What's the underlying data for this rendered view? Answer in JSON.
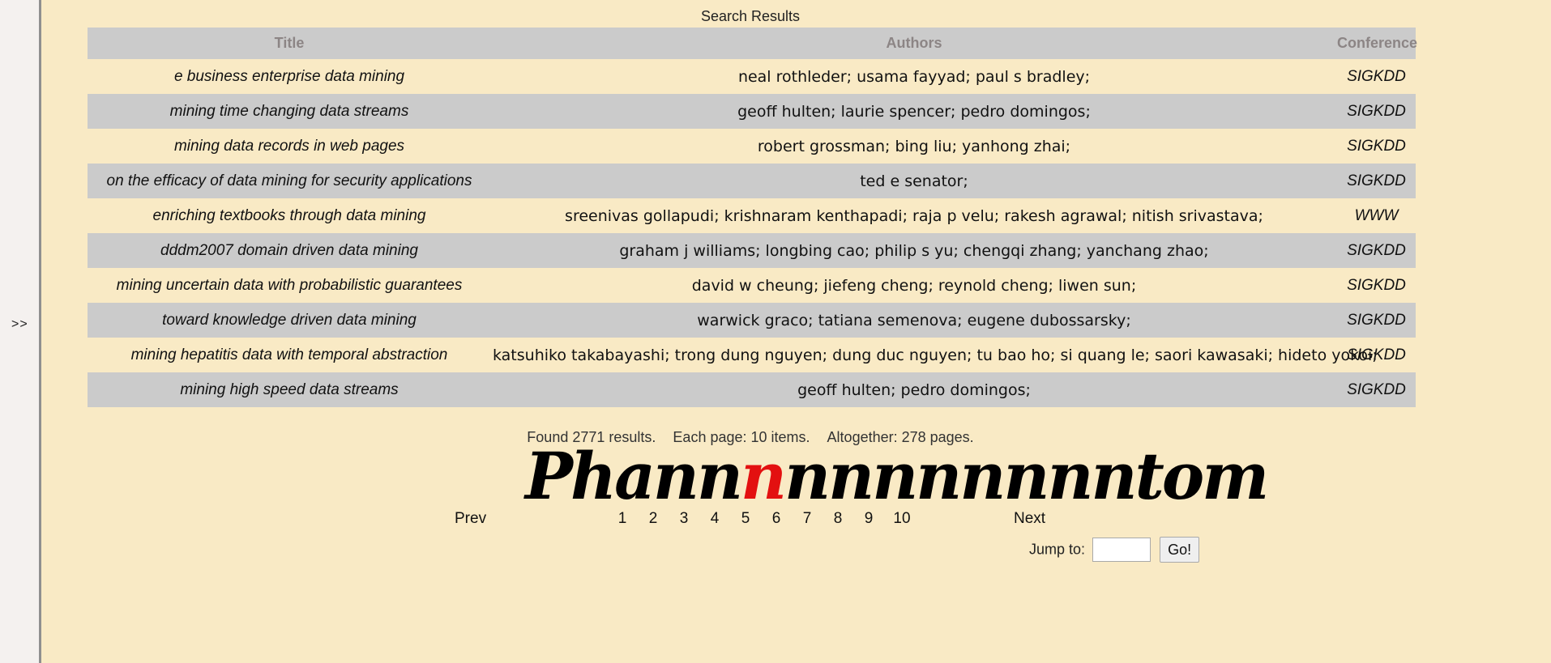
{
  "sidebar": {
    "toggle_label": ">>"
  },
  "heading": "Search Results",
  "table": {
    "headers": [
      "Title",
      "Authors",
      "Conference"
    ],
    "rows": [
      {
        "title": "e business enterprise data mining",
        "authors": "neal rothleder; usama fayyad; paul s bradley;",
        "conference": "SIGKDD"
      },
      {
        "title": "mining time changing data streams",
        "authors": "geoff hulten; laurie spencer; pedro domingos;",
        "conference": "SIGKDD"
      },
      {
        "title": "mining data records in web pages",
        "authors": "robert grossman; bing liu; yanhong zhai;",
        "conference": "SIGKDD"
      },
      {
        "title": "on the efficacy of data mining for security applications",
        "authors": "ted e senator;",
        "conference": "SIGKDD"
      },
      {
        "title": "enriching textbooks through data mining",
        "authors": "sreenivas gollapudi; krishnaram kenthapadi; raja p velu; rakesh agrawal; nitish srivastava;",
        "conference": "WWW"
      },
      {
        "title": "dddm2007 domain driven data mining",
        "authors": "graham j williams; longbing cao; philip s yu; chengqi zhang; yanchang zhao;",
        "conference": "SIGKDD"
      },
      {
        "title": "mining uncertain data with probabilistic guarantees",
        "authors": "david w cheung; jiefeng cheng; reynold cheng; liwen sun;",
        "conference": "SIGKDD"
      },
      {
        "title": "toward knowledge driven data mining",
        "authors": "warwick graco; tatiana semenova; eugene dubossarsky;",
        "conference": "SIGKDD"
      },
      {
        "title": "mining hepatitis data with temporal abstraction",
        "authors": "katsuhiko takabayashi; trong dung nguyen; dung duc nguyen; tu bao ho; si quang le; saori kawasaki; hideto yokoi;",
        "conference": "SIGKDD"
      },
      {
        "title": "mining high speed data streams",
        "authors": "geoff hulten; pedro domingos;",
        "conference": "SIGKDD"
      }
    ]
  },
  "summary": {
    "found": "Found 2771 results.",
    "per_page": "Each page: 10 items.",
    "total_pages": "Altogether: 278 pages."
  },
  "logo": {
    "before": "Phann",
    "highlight": "n",
    "after": "nnnnnnnntom",
    "highlight_color": "#e31010"
  },
  "pager": {
    "prev_label": "Prev",
    "next_label": "Next",
    "pages": [
      "1",
      "2",
      "3",
      "4",
      "5",
      "6",
      "7",
      "8",
      "9",
      "10"
    ],
    "current_page": "4"
  },
  "jump": {
    "label": "Jump to:",
    "value": "",
    "button_label": "Go!"
  },
  "colors": {
    "background": "#f9eac5",
    "row_alt": "#cbcbcb",
    "header_text": "#8c8585"
  }
}
